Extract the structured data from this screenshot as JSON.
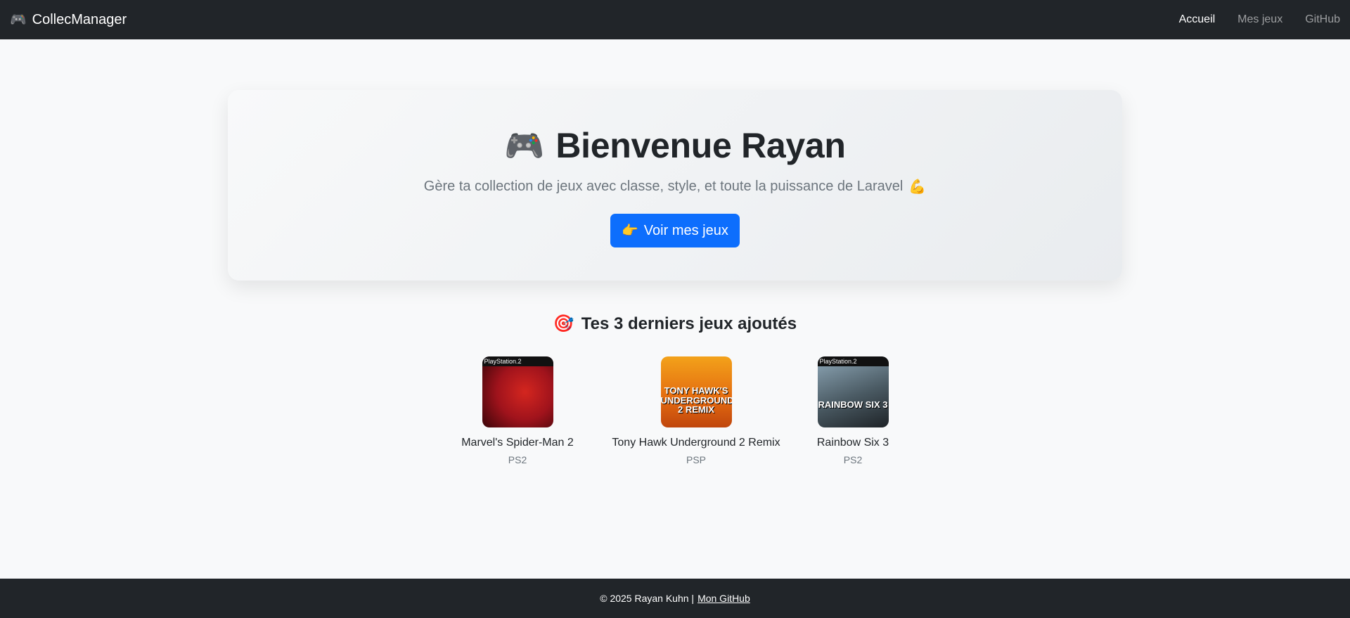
{
  "navbar": {
    "brand_icon": "🎮",
    "brand": "CollecManager",
    "links": [
      {
        "label": "Accueil",
        "active": true
      },
      {
        "label": "Mes jeux",
        "active": false
      },
      {
        "label": "GitHub",
        "active": false
      }
    ]
  },
  "hero": {
    "title_icon": "🎮",
    "title": "Bienvenue Rayan",
    "subtitle": "Gère ta collection de jeux avec classe, style, et toute la puissance de Laravel",
    "subtitle_icon": "💪",
    "button_icon": "👉",
    "button_label": "Voir mes jeux"
  },
  "recent": {
    "title_icon": "🎯",
    "title": "Tes 3 derniers jeux ajoutés",
    "games": [
      {
        "name": "Marvel's Spider-Man 2",
        "platform": "PS2",
        "cover_label": "PlayStation.2"
      },
      {
        "name": "Tony Hawk Underground 2 Remix",
        "platform": "PSP",
        "cover_label": "TONY HAWK'S UNDERGROUND 2 REMIX"
      },
      {
        "name": "Rainbow Six 3",
        "platform": "PS2",
        "cover_label": "PlayStation.2",
        "cover_title": "RAINBOW SIX 3"
      }
    ]
  },
  "footer": {
    "text": "© 2025 Rayan Kuhn |",
    "link": "Mon GitHub"
  },
  "colors": {
    "navbar_bg": "#212529",
    "primary": "#0d6efd",
    "page_bg": "#f8f9fa",
    "muted": "#6c757d"
  }
}
